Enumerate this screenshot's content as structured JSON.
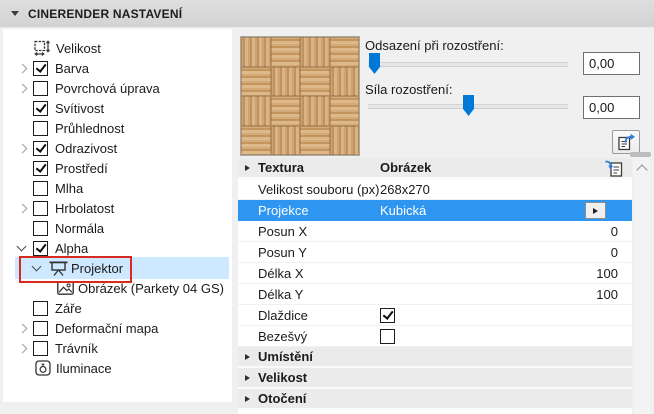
{
  "header": {
    "title": "CINERENDER NASTAVENÍ"
  },
  "tree": {
    "items": [
      {
        "label": "Velikost",
        "icon": "size-icon"
      },
      {
        "label": "Barva",
        "expander": "collapsed",
        "check": "checked"
      },
      {
        "label": "Povrchová úprava",
        "expander": "collapsed",
        "check": "unchecked"
      },
      {
        "label": "Svítivost",
        "check": "checked"
      },
      {
        "label": "Průhlednost",
        "check": "unchecked"
      },
      {
        "label": "Odrazivost",
        "expander": "collapsed",
        "check": "checked"
      },
      {
        "label": "Prostředí",
        "check": "checked"
      },
      {
        "label": "Mlha",
        "check": "unchecked"
      },
      {
        "label": "Hrbolatost",
        "expander": "collapsed",
        "check": "unchecked"
      },
      {
        "label": "Normála",
        "check": "unchecked"
      },
      {
        "label": "Alpha",
        "expander": "expanded",
        "check": "checked"
      },
      {
        "label": "Projektor",
        "expander": "expanded",
        "icon": "projector-icon",
        "selected": true,
        "annotated": true
      },
      {
        "label": "Obrázek (Parkety 04 GS)",
        "icon": "image-icon"
      },
      {
        "label": "Záře",
        "check": "unchecked"
      },
      {
        "label": "Deformační mapa",
        "expander": "collapsed",
        "check": "unchecked"
      },
      {
        "label": "Trávník",
        "expander": "collapsed",
        "check": "unchecked"
      },
      {
        "label": "Iluminace",
        "icon": "lamp-icon"
      }
    ]
  },
  "preview": {
    "description": "parquet wood texture swatch (Parkety 04 GS)"
  },
  "blur_controls": {
    "offset_label": "Odsazení při rozostření:",
    "offset_value": "0,00",
    "strength_label": "Síla rozostření:",
    "strength_value": "0,00"
  },
  "table": {
    "rows": [
      {
        "type": "group",
        "label": "Textura",
        "value": "Obrázek",
        "icon": "import-settings-icon"
      },
      {
        "type": "property",
        "label": "Velikost souboru (px)",
        "value": "268x270"
      },
      {
        "type": "property",
        "label": "Projekce",
        "value": "Kubická",
        "selected": true,
        "flyout": true
      },
      {
        "type": "property",
        "label": "Posun X",
        "value": "0"
      },
      {
        "type": "property",
        "label": "Posun Y",
        "value": "0"
      },
      {
        "type": "property",
        "label": "Délka X",
        "value": "100"
      },
      {
        "type": "property",
        "label": "Délka Y",
        "value": "100"
      },
      {
        "type": "checkbox",
        "label": "Dlaždice",
        "check": "checked"
      },
      {
        "type": "checkbox",
        "label": "Bezešvý",
        "check": "unchecked"
      },
      {
        "type": "group",
        "label": "Umístění"
      },
      {
        "type": "group",
        "label": "Velikost"
      },
      {
        "type": "group",
        "label": "Otočení"
      }
    ]
  },
  "colors": {
    "header_bg": "#d8d8d8",
    "panel_bg": "#f0f0f0",
    "tree_selection": "#cde8ff",
    "row_selection": "#2e96f0",
    "slider_accent": "#0078d7",
    "annotation_red": "#d92a1f",
    "group_row_bg": "#ebebeb"
  }
}
